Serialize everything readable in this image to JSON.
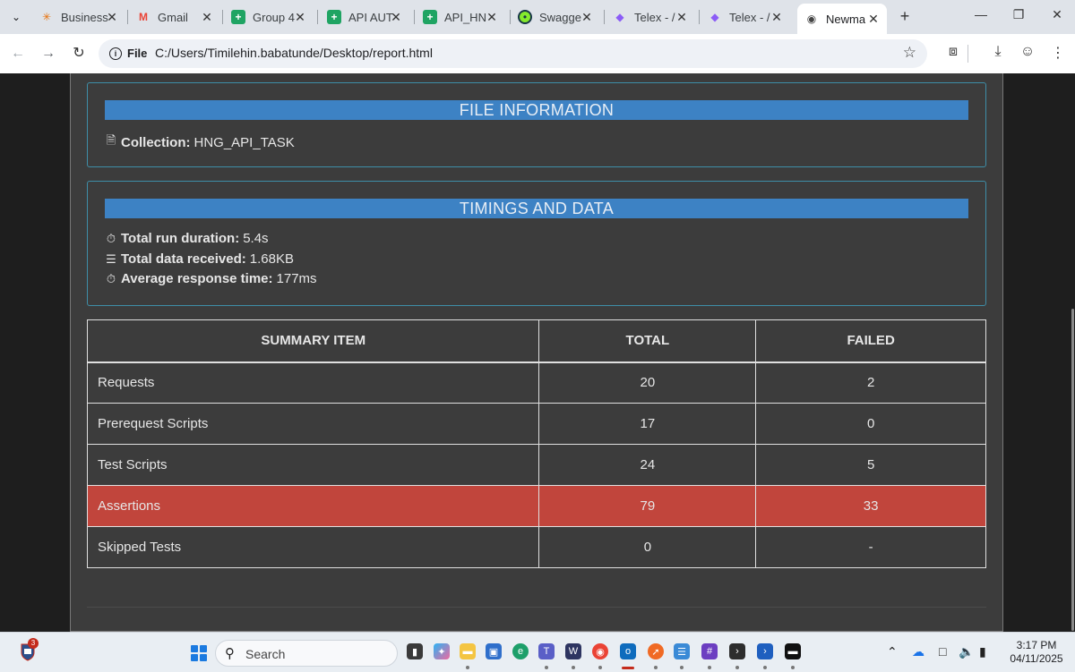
{
  "browser": {
    "tabs": [
      {
        "title": "Business",
        "icon": "asterisk-icon",
        "active": false
      },
      {
        "title": "Gmail",
        "icon": "gmail-icon",
        "active": false
      },
      {
        "title": "Group 4",
        "icon": "sheets-icon",
        "active": false
      },
      {
        "title": "API AUT",
        "icon": "sheets-icon",
        "active": false
      },
      {
        "title": "API_HN",
        "icon": "sheets-icon",
        "active": false
      },
      {
        "title": "Swagge",
        "icon": "swagger-icon",
        "active": false
      },
      {
        "title": "Telex - /",
        "icon": "telex-icon",
        "active": false
      },
      {
        "title": "Telex - /",
        "icon": "telex-icon",
        "active": false
      },
      {
        "title": "Newma",
        "icon": "globe-icon",
        "active": true
      }
    ],
    "new_tab": "+",
    "address": {
      "scheme_label": "File",
      "url": "C:/Users/Timilehin.babatunde/Desktop/report.html"
    }
  },
  "report": {
    "file_info": {
      "heading": "FILE INFORMATION",
      "collection_label": "Collection:",
      "collection_value": "HNG_API_TASK"
    },
    "timings": {
      "heading": "TIMINGS AND DATA",
      "duration_label": "Total run duration:",
      "duration_value": "5.4s",
      "data_label": "Total data received:",
      "data_value": "1.68KB",
      "avg_label": "Average response time:",
      "avg_value": "177ms"
    },
    "summary": {
      "headers": [
        "SUMMARY ITEM",
        "TOTAL",
        "FAILED"
      ],
      "rows": [
        {
          "item": "Requests",
          "total": "20",
          "failed": "2",
          "highlight": false
        },
        {
          "item": "Prerequest Scripts",
          "total": "17",
          "failed": "0",
          "highlight": false
        },
        {
          "item": "Test Scripts",
          "total": "24",
          "failed": "5",
          "highlight": false
        },
        {
          "item": "Assertions",
          "total": "79",
          "failed": "33",
          "highlight": true
        },
        {
          "item": "Skipped Tests",
          "total": "0",
          "failed": "-",
          "highlight": false
        }
      ]
    }
  },
  "taskbar": {
    "notification_count": "3",
    "search_placeholder": "Search",
    "time": "3:17 PM",
    "date": "04/11/2025"
  },
  "colors": {
    "header_blue": "#3d82c4",
    "card_border": "#3e8ea8",
    "danger_row": "#c1453c",
    "report_bg": "#3c3c3c"
  }
}
